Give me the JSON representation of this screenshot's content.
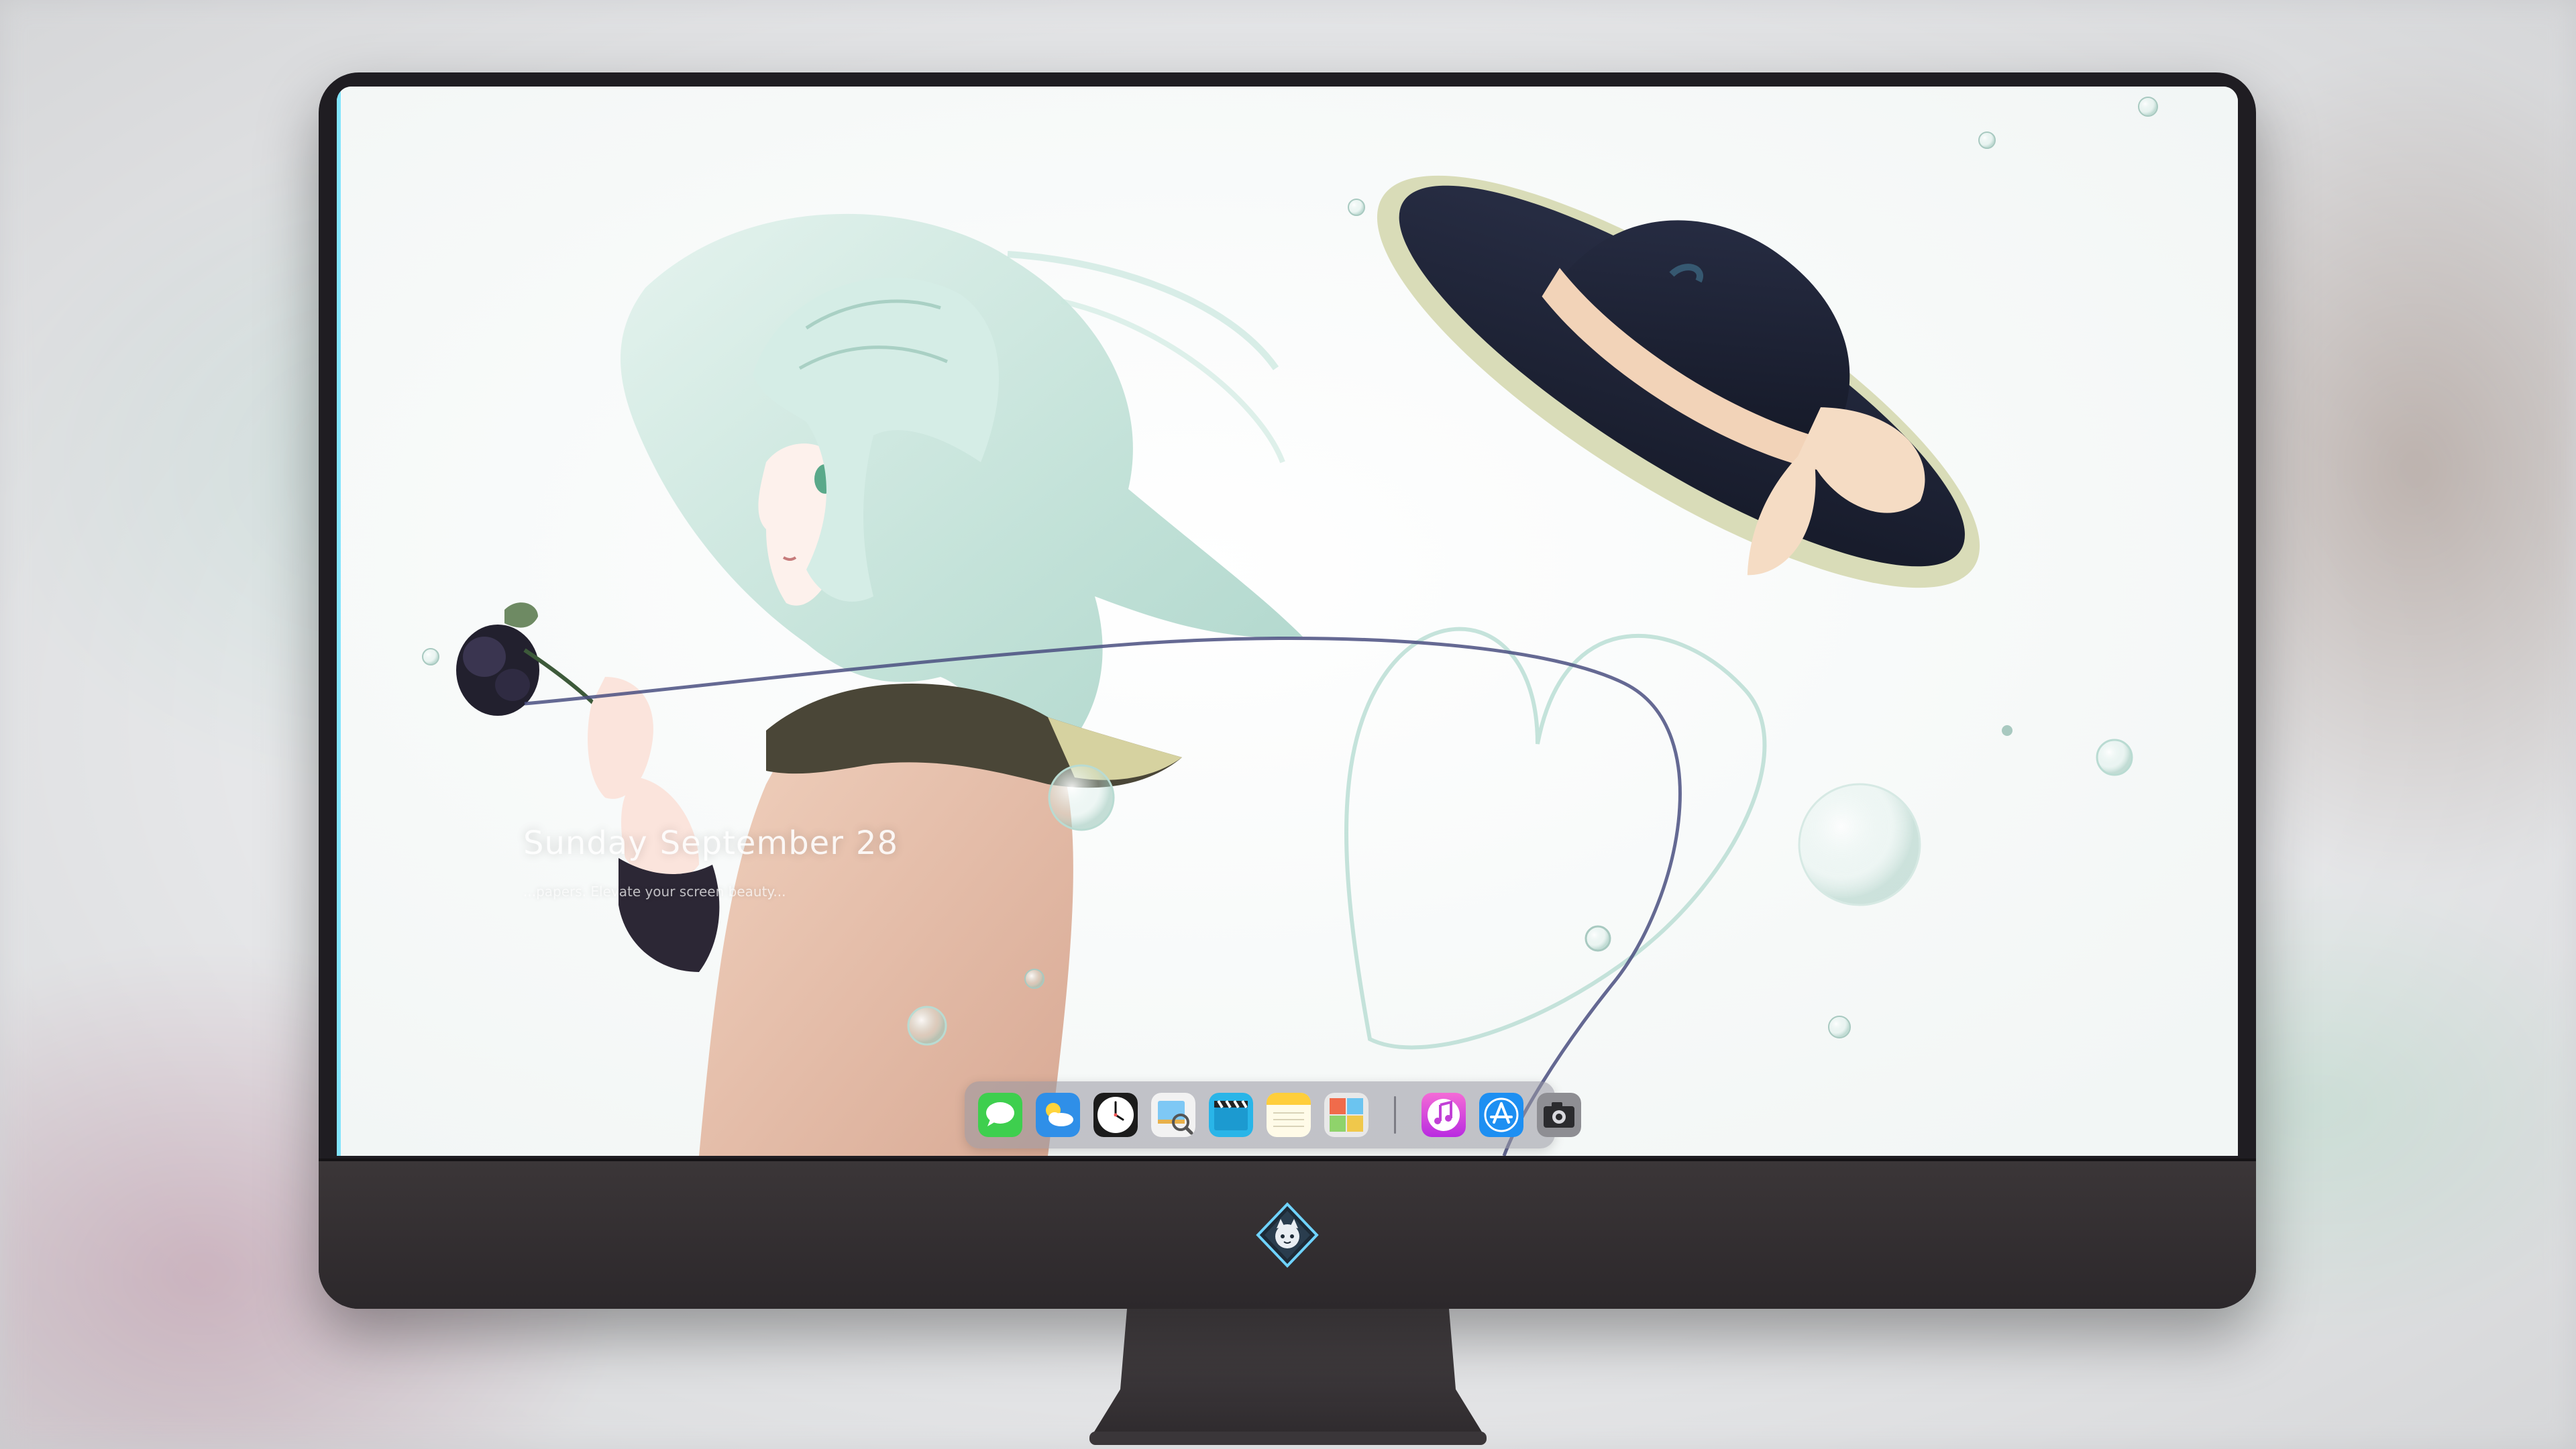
{
  "lock_screen": {
    "day": "Sunday",
    "month": "September",
    "date": "28",
    "tagline": "...papers. Elevate your screen beauty..."
  },
  "dock": {
    "apps": [
      {
        "name": "Messages",
        "icon": "messages-icon"
      },
      {
        "name": "Weather",
        "icon": "weather-icon"
      },
      {
        "name": "Clock",
        "icon": "clock-icon"
      },
      {
        "name": "Preview",
        "icon": "preview-icon"
      },
      {
        "name": "Clips",
        "icon": "clapperboard-icon"
      },
      {
        "name": "Notes",
        "icon": "notes-icon"
      },
      {
        "name": "Photo Booth",
        "icon": "photo-booth-icon"
      },
      {
        "name": "Music",
        "icon": "music-icon"
      },
      {
        "name": "App Store",
        "icon": "app-store-icon"
      },
      {
        "name": "Camera",
        "icon": "camera-icon"
      }
    ]
  },
  "colors": {
    "monitor_bezel": "#1f1d22",
    "chin": "#3b3638",
    "dock_bg": "#9696a0",
    "hat": "#1a1f33",
    "ribbon": "#f2d3b8",
    "hair": "#bfe3d7"
  }
}
